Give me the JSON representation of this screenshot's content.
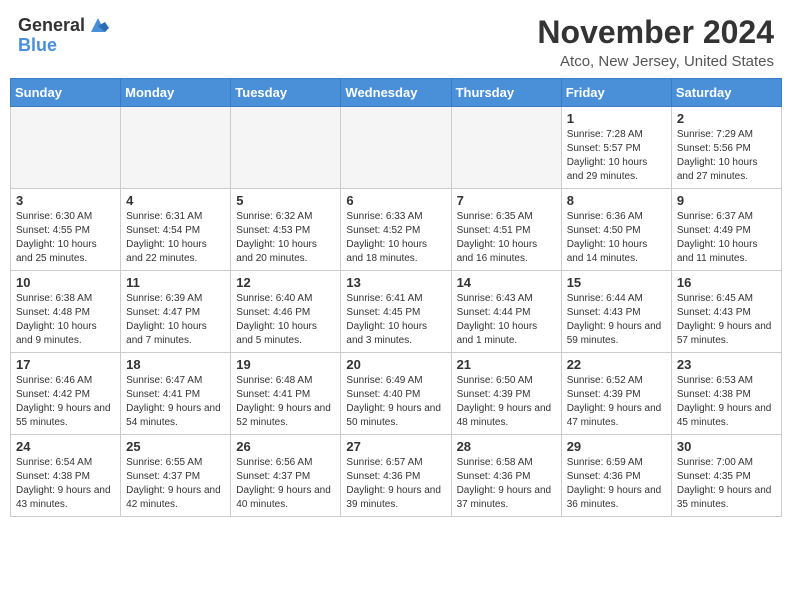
{
  "header": {
    "logo_general": "General",
    "logo_blue": "Blue",
    "month": "November 2024",
    "location": "Atco, New Jersey, United States"
  },
  "days_of_week": [
    "Sunday",
    "Monday",
    "Tuesday",
    "Wednesday",
    "Thursday",
    "Friday",
    "Saturday"
  ],
  "weeks": [
    [
      {
        "day": "",
        "info": ""
      },
      {
        "day": "",
        "info": ""
      },
      {
        "day": "",
        "info": ""
      },
      {
        "day": "",
        "info": ""
      },
      {
        "day": "",
        "info": ""
      },
      {
        "day": "1",
        "info": "Sunrise: 7:28 AM\nSunset: 5:57 PM\nDaylight: 10 hours and 29 minutes."
      },
      {
        "day": "2",
        "info": "Sunrise: 7:29 AM\nSunset: 5:56 PM\nDaylight: 10 hours and 27 minutes."
      }
    ],
    [
      {
        "day": "3",
        "info": "Sunrise: 6:30 AM\nSunset: 4:55 PM\nDaylight: 10 hours and 25 minutes."
      },
      {
        "day": "4",
        "info": "Sunrise: 6:31 AM\nSunset: 4:54 PM\nDaylight: 10 hours and 22 minutes."
      },
      {
        "day": "5",
        "info": "Sunrise: 6:32 AM\nSunset: 4:53 PM\nDaylight: 10 hours and 20 minutes."
      },
      {
        "day": "6",
        "info": "Sunrise: 6:33 AM\nSunset: 4:52 PM\nDaylight: 10 hours and 18 minutes."
      },
      {
        "day": "7",
        "info": "Sunrise: 6:35 AM\nSunset: 4:51 PM\nDaylight: 10 hours and 16 minutes."
      },
      {
        "day": "8",
        "info": "Sunrise: 6:36 AM\nSunset: 4:50 PM\nDaylight: 10 hours and 14 minutes."
      },
      {
        "day": "9",
        "info": "Sunrise: 6:37 AM\nSunset: 4:49 PM\nDaylight: 10 hours and 11 minutes."
      }
    ],
    [
      {
        "day": "10",
        "info": "Sunrise: 6:38 AM\nSunset: 4:48 PM\nDaylight: 10 hours and 9 minutes."
      },
      {
        "day": "11",
        "info": "Sunrise: 6:39 AM\nSunset: 4:47 PM\nDaylight: 10 hours and 7 minutes."
      },
      {
        "day": "12",
        "info": "Sunrise: 6:40 AM\nSunset: 4:46 PM\nDaylight: 10 hours and 5 minutes."
      },
      {
        "day": "13",
        "info": "Sunrise: 6:41 AM\nSunset: 4:45 PM\nDaylight: 10 hours and 3 minutes."
      },
      {
        "day": "14",
        "info": "Sunrise: 6:43 AM\nSunset: 4:44 PM\nDaylight: 10 hours and 1 minute."
      },
      {
        "day": "15",
        "info": "Sunrise: 6:44 AM\nSunset: 4:43 PM\nDaylight: 9 hours and 59 minutes."
      },
      {
        "day": "16",
        "info": "Sunrise: 6:45 AM\nSunset: 4:43 PM\nDaylight: 9 hours and 57 minutes."
      }
    ],
    [
      {
        "day": "17",
        "info": "Sunrise: 6:46 AM\nSunset: 4:42 PM\nDaylight: 9 hours and 55 minutes."
      },
      {
        "day": "18",
        "info": "Sunrise: 6:47 AM\nSunset: 4:41 PM\nDaylight: 9 hours and 54 minutes."
      },
      {
        "day": "19",
        "info": "Sunrise: 6:48 AM\nSunset: 4:41 PM\nDaylight: 9 hours and 52 minutes."
      },
      {
        "day": "20",
        "info": "Sunrise: 6:49 AM\nSunset: 4:40 PM\nDaylight: 9 hours and 50 minutes."
      },
      {
        "day": "21",
        "info": "Sunrise: 6:50 AM\nSunset: 4:39 PM\nDaylight: 9 hours and 48 minutes."
      },
      {
        "day": "22",
        "info": "Sunrise: 6:52 AM\nSunset: 4:39 PM\nDaylight: 9 hours and 47 minutes."
      },
      {
        "day": "23",
        "info": "Sunrise: 6:53 AM\nSunset: 4:38 PM\nDaylight: 9 hours and 45 minutes."
      }
    ],
    [
      {
        "day": "24",
        "info": "Sunrise: 6:54 AM\nSunset: 4:38 PM\nDaylight: 9 hours and 43 minutes."
      },
      {
        "day": "25",
        "info": "Sunrise: 6:55 AM\nSunset: 4:37 PM\nDaylight: 9 hours and 42 minutes."
      },
      {
        "day": "26",
        "info": "Sunrise: 6:56 AM\nSunset: 4:37 PM\nDaylight: 9 hours and 40 minutes."
      },
      {
        "day": "27",
        "info": "Sunrise: 6:57 AM\nSunset: 4:36 PM\nDaylight: 9 hours and 39 minutes."
      },
      {
        "day": "28",
        "info": "Sunrise: 6:58 AM\nSunset: 4:36 PM\nDaylight: 9 hours and 37 minutes."
      },
      {
        "day": "29",
        "info": "Sunrise: 6:59 AM\nSunset: 4:36 PM\nDaylight: 9 hours and 36 minutes."
      },
      {
        "day": "30",
        "info": "Sunrise: 7:00 AM\nSunset: 4:35 PM\nDaylight: 9 hours and 35 minutes."
      }
    ]
  ]
}
